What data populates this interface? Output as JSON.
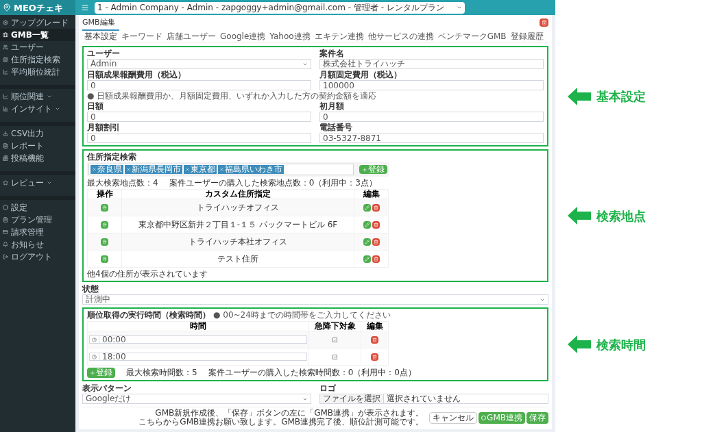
{
  "sidebar": {
    "logo": "MEOチェキ",
    "groups": [
      [
        {
          "label": "アップグレード",
          "kind": "link",
          "selected": false
        },
        {
          "label": "GMB一覧",
          "kind": "link",
          "selected": true
        },
        {
          "label": "ユーザー",
          "kind": "link",
          "selected": false
        },
        {
          "label": "住所指定検索",
          "kind": "link",
          "selected": false
        },
        {
          "label": "平均順位統計",
          "kind": "link",
          "selected": false
        }
      ],
      [
        {
          "label": "順位関連",
          "kind": "group",
          "selected": false
        },
        {
          "label": "インサイト",
          "kind": "group",
          "selected": false
        }
      ],
      [
        {
          "label": "CSV出力",
          "kind": "link",
          "selected": false
        },
        {
          "label": "レポート",
          "kind": "link",
          "selected": false
        },
        {
          "label": "投稿機能",
          "kind": "link",
          "selected": false
        }
      ],
      [
        {
          "label": "レビュー",
          "kind": "group",
          "selected": false
        }
      ],
      [
        {
          "label": "設定",
          "kind": "link",
          "selected": false
        },
        {
          "label": "プラン管理",
          "kind": "link",
          "selected": false
        },
        {
          "label": "請求管理",
          "kind": "link",
          "selected": false
        },
        {
          "label": "お知らせ",
          "kind": "link",
          "selected": false
        },
        {
          "label": "ログアウト",
          "kind": "link",
          "selected": false
        }
      ]
    ]
  },
  "header": {
    "account_select": "1 - Admin Company - Admin - zapgoggy+admin@gmail.com - 管理者 - レンタルプラン"
  },
  "card": {
    "title": "GMB編集",
    "tabs": [
      {
        "label": "基本設定",
        "selected": true
      },
      {
        "label": "キーワード",
        "selected": false
      },
      {
        "label": "店舗ユーザー",
        "selected": false
      },
      {
        "label": "Google連携",
        "selected": false
      },
      {
        "label": "Yahoo連携",
        "selected": false
      },
      {
        "label": "エキテン連携",
        "selected": false
      },
      {
        "label": "他サービスの連携",
        "selected": false
      },
      {
        "label": "ベンチマークGMB",
        "selected": false
      },
      {
        "label": "登録履歴",
        "selected": false
      }
    ],
    "basic": {
      "annotation": "基本設定",
      "fields": [
        {
          "label": "ユーザー",
          "value": "Admin",
          "kind": "select"
        },
        {
          "label": "案件名",
          "value": "株式会社トライハッチ",
          "kind": "text"
        },
        {
          "label": "日額成果報酬費用（税込）",
          "value": "0",
          "kind": "text"
        },
        {
          "label": "月額固定費用（税込）",
          "value": "100000",
          "kind": "text",
          "help": "● 日額成果報酬費用か、月額固定費用、いずれか入力した方の契約金額を適応"
        },
        {
          "label": "日額",
          "value": "0",
          "kind": "text"
        },
        {
          "label": "初月額",
          "value": "0",
          "kind": "text"
        },
        {
          "label": "月額割引",
          "value": "0",
          "kind": "text"
        },
        {
          "label": "電話番号",
          "value": "03-5327-8871",
          "kind": "text"
        }
      ]
    },
    "locations": {
      "annotation": "検索地点",
      "label": "住所指定検索",
      "tags": [
        "奈良県",
        "新潟県長岡市",
        "東京都",
        "福島県いわき市"
      ],
      "add_button": "登録",
      "max_text": "最大検索地点数：4",
      "purchased_text": "案件ユーザーの購入した検索地点数：0（利用中：3点）",
      "columns": [
        "操作",
        "カスタム住所指定",
        "編集"
      ],
      "rows": [
        {
          "address": "トライハッチオフィス"
        },
        {
          "address": "東京都中野区新井２丁目１-１５ パックマートビル 6F"
        },
        {
          "address": "トライハッチ本社オフィス"
        },
        {
          "address": "テスト住所"
        }
      ],
      "footer": "他4個の住所が表示されています"
    },
    "status": {
      "label": "状態",
      "value": "計測中"
    },
    "times": {
      "annotation": "検索時間",
      "title": "順位取得の実行時間（検索時間）",
      "hint": "● 00~24時までの時間帯をご入力してください",
      "columns": [
        "時間",
        "急降下対象",
        "編集"
      ],
      "rows": [
        {
          "time": "00:00",
          "checked": true
        },
        {
          "time": "18:00",
          "checked": true
        }
      ],
      "add_button": "登録",
      "max_text": "最大検索時間数：5",
      "purchased_text": "案件ユーザーの購入した検索時間数：0（利用中：0点）"
    },
    "display": {
      "label": "表示パターン",
      "value": "Googleだけ"
    },
    "logo": {
      "label": "ロゴ",
      "file_button": "ファイルを選択",
      "file_status": "選択されていません"
    },
    "actions": [
      {
        "label": "キャンセル",
        "kind": "cancel"
      },
      {
        "label": "GMB連携",
        "kind": "gmb"
      },
      {
        "label": "保存",
        "kind": "save"
      }
    ],
    "note": [
      "GMB新規作成後、「保存」ボタンの左に「GMB連携」が表示されます。",
      "こちらからGMB連携お願い致します。GMB連携完了後、順位計測可能です。"
    ]
  }
}
